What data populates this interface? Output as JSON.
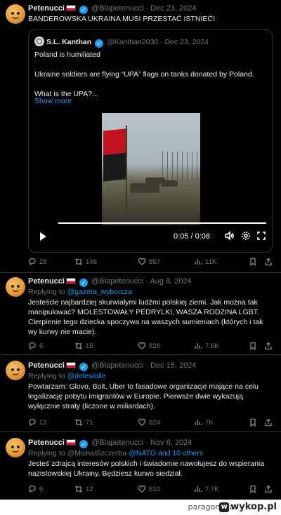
{
  "colors": {
    "background": "#000000",
    "text": "#e7e9ea",
    "muted": "#71767b",
    "accent": "#1d9bf0",
    "border": "#2f3336"
  },
  "tweets": [
    {
      "name": "Petenucci",
      "handle": "@Blapetenucci",
      "date": "Dec 23, 2024",
      "text": "BANDEROWSKA UKRAINA MUSI PRZESTAĆ ISTNIEĆ!",
      "stats": {
        "replies": "28",
        "reposts": "148",
        "likes": "857",
        "views": "11K"
      }
    },
    {
      "name": "Petenucci",
      "handle": "@Blapetenucci",
      "date": "Aug 8, 2024",
      "replying_prefix": "Replying to ",
      "replying_to": "@gazeta_wyborcza",
      "text": "Jesteście najbardziej skurwiałymi ludźmi polskiej ziemi. Jak można tak manipulować? MOLESTOWAŁY PEDRYLKI, WASZA RODZINA LGBT. Clerpienie tego dziecka spoczywa na waszych sumieniach (których i tak wy kurwy nie macie).",
      "stats": {
        "replies": "6",
        "reposts": "15",
        "likes": "828",
        "views": "7.6K"
      }
    },
    {
      "name": "Petenucci",
      "handle": "@Blapetenucci",
      "date": "Dec 15, 2024",
      "replying_prefix": "Replying to ",
      "replying_to": "@delestoile",
      "text": "Powtarzam: Glovo, Bolt, Uber to fasadowe organizacje mające na celu legalizację pobytu imigrantów w Europie. Pierwsze dwie wykazują wyłącznie straty (liczone w miliardach).",
      "stats": {
        "replies": "12",
        "reposts": "71",
        "likes": "824",
        "views": "7K"
      }
    },
    {
      "name": "Petenucci",
      "handle": "@Blapetenucci",
      "date": "Nov 6, 2024",
      "replying_prefix": "Replying to @MichalSzczerba ",
      "replying_to": "@NATO and 10 others",
      "text": "Jesteś zdrajcą interesów polskich i świadomie nawołujesz do wspierania nazistowskiej Ukrainy. Będziesz kurwo siedział.",
      "stats": {
        "replies": "6",
        "reposts": "12",
        "likes": "810",
        "views": "7.7K"
      }
    }
  ],
  "quote": {
    "name": "S.L. Kanthan",
    "handle": "@Kanthan2030",
    "date": "Dec 23, 2024",
    "line1": "Poland is humiliated",
    "line2": "Ukraine soldiers are flying “UPA” flags on tanks donated by Poland.",
    "line3": "What is the UPA?...",
    "show_more": "Show more",
    "video": {
      "time": "0:05 / 0:08",
      "progress": 1.0
    }
  },
  "footer": {
    "credit": "paragonik z",
    "logo": "wykop.pl"
  }
}
